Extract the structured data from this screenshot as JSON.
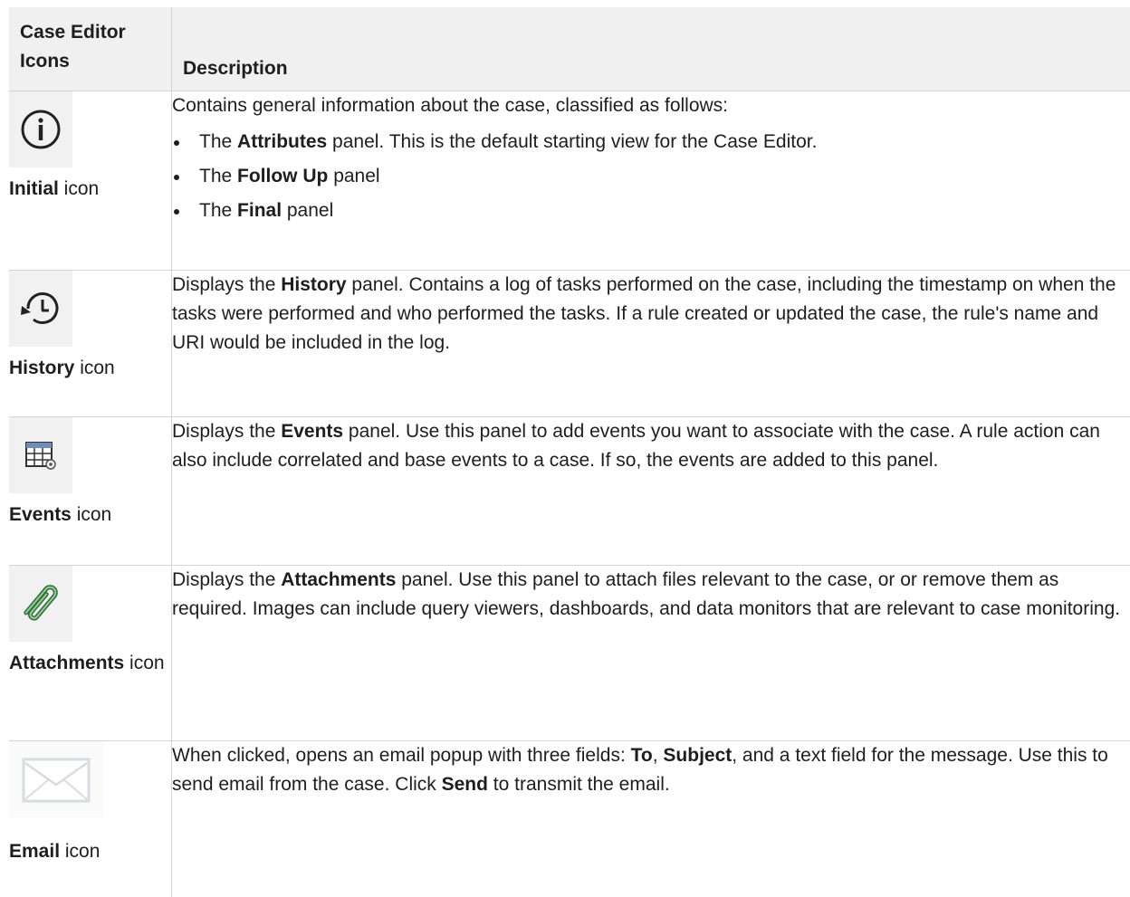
{
  "header": {
    "col1": "Case Editor Icons",
    "col2": "Description"
  },
  "rows": [
    {
      "icon": "info-icon",
      "label_bold": "Initial",
      "label_rest": " icon",
      "intro": "Contains general information about the case, classified as follows:",
      "bullets": [
        {
          "pre": "The ",
          "bold": "Attributes",
          "post": " panel. This is the default starting view for the Case Editor."
        },
        {
          "pre": "The ",
          "bold": "Follow Up",
          "post": " panel"
        },
        {
          "pre": "The ",
          "bold": "Final",
          "post": " panel"
        }
      ]
    },
    {
      "icon": "history-icon",
      "label_bold": "History",
      "label_rest": " icon",
      "desc_pre": "Displays the ",
      "desc_bold": "History",
      "desc_post": " panel. Contains a log of tasks performed on the case, including the timestamp on when the tasks were performed and who performed the tasks. If a rule created or updated the case, the rule's name and URI would be included in the log."
    },
    {
      "icon": "events-grid-icon",
      "label_bold": "Events",
      "label_rest": " icon",
      "desc_pre": "Displays the ",
      "desc_bold": "Events",
      "desc_post": " panel. Use this panel to add events you want to associate with the case. A rule action can also include correlated and base events to a case. If so, the events are added to this panel."
    },
    {
      "icon": "paperclip-icon",
      "label_bold": "Attachments",
      "label_rest": " icon",
      "desc_pre": "Displays the ",
      "desc_bold": "Attachments",
      "desc_post": " panel. Use this panel to attach files relevant to the case, or or remove them as required. Images can include query viewers, dashboards, and data monitors that are relevant to case monitoring."
    },
    {
      "icon": "envelope-icon",
      "label_bold": "Email",
      "label_rest": " icon",
      "desc_a": "When clicked, opens an email popup with three fields: ",
      "desc_to": "To",
      "desc_b": ", ",
      "desc_subject": "Subject",
      "desc_c": ", and a text field for the message. Use this to send email from the case. Click ",
      "desc_send": "Send",
      "desc_d": " to transmit the email."
    }
  ]
}
